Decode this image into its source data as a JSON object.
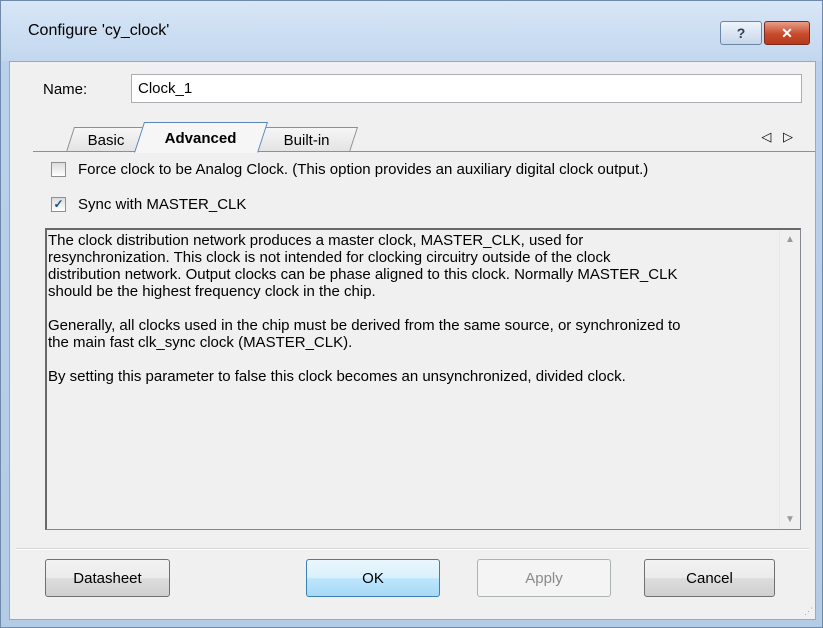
{
  "window": {
    "title": "Configure 'cy_clock'",
    "help_label": "?",
    "close_label": "✕"
  },
  "name": {
    "label": "Name:",
    "value": "Clock_1"
  },
  "tabs": [
    {
      "label": "Basic"
    },
    {
      "label": "Advanced",
      "active": true
    },
    {
      "label": "Built-in"
    }
  ],
  "tab_arrows": "◁ ▷",
  "options": {
    "analog": {
      "label": "Force clock to be Analog Clock. (This option provides an auxiliary digital clock output.)",
      "checked": false
    },
    "sync": {
      "label": "Sync with MASTER_CLK",
      "checked": true,
      "check_mark": "✓"
    }
  },
  "description": "The clock distribution network produces a master clock, MASTER_CLK, used for\nresynchronization. This clock is not intended for clocking circuitry outside of the clock\ndistribution network. Output clocks can be phase aligned to this clock. Normally MASTER_CLK\nshould be the highest frequency clock in the chip.\n\nGenerally, all clocks used in the chip must be derived from the same source, or synchronized to\nthe main fast clk_sync clock (MASTER_CLK).\n\nBy setting this parameter to false this clock becomes an unsynchronized, divided clock.",
  "buttons": {
    "datasheet": "Datasheet",
    "ok": "OK",
    "apply": "Apply",
    "cancel": "Cancel"
  }
}
